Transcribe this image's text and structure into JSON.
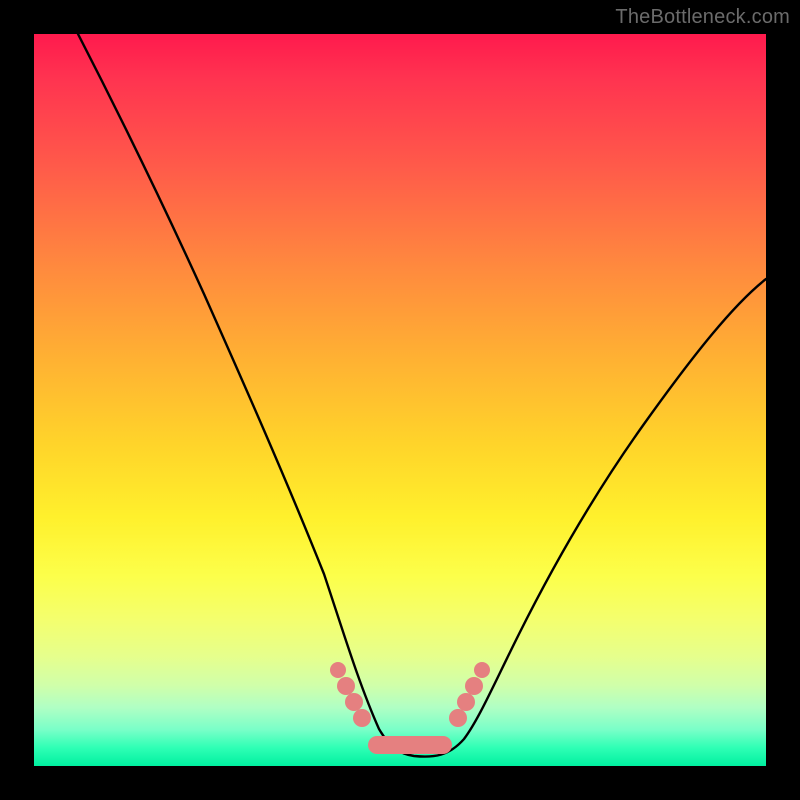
{
  "watermark": "TheBottleneck.com",
  "colors": {
    "frame": "#000000",
    "curve": "#000000",
    "markers": "#e58080",
    "gradient_stops": [
      "#ff1a4d",
      "#ff3350",
      "#ff5a4a",
      "#ff8a3e",
      "#ffb033",
      "#ffd42a",
      "#fff02c",
      "#fcff4a",
      "#f4ff6e",
      "#e6ff8c",
      "#d0ffaa",
      "#b0ffc4",
      "#7affc8",
      "#2fffb5",
      "#00f0a0"
    ]
  },
  "chart_data": {
    "type": "line",
    "title": "",
    "xlabel": "",
    "ylabel": "",
    "xlim": [
      0,
      100
    ],
    "ylim": [
      0,
      100
    ],
    "grid": false,
    "series": [
      {
        "name": "bottleneck-curve",
        "x": [
          6,
          10,
          14,
          18,
          22,
          26,
          30,
          34,
          38,
          41,
          43,
          45,
          47,
          49,
          51,
          53,
          55,
          57,
          60,
          64,
          68,
          72,
          76,
          80,
          84,
          88,
          92,
          96,
          100
        ],
        "y": [
          100,
          92,
          84,
          76,
          68,
          60,
          52,
          44,
          36,
          28,
          22,
          16,
          10,
          6,
          4,
          4,
          5,
          8,
          12,
          18,
          24,
          30,
          36,
          42,
          48,
          53,
          58,
          62,
          66
        ]
      }
    ],
    "annotations": {
      "left_cluster_dots": [
        {
          "x": 41,
          "y": 14
        },
        {
          "x": 42,
          "y": 12
        },
        {
          "x": 43,
          "y": 10
        },
        {
          "x": 44,
          "y": 8
        }
      ],
      "right_cluster_dots": [
        {
          "x": 57,
          "y": 8
        },
        {
          "x": 58,
          "y": 10
        },
        {
          "x": 59,
          "y": 12
        },
        {
          "x": 60,
          "y": 14
        }
      ],
      "flat_pill": {
        "x0": 45,
        "x1": 55,
        "y": 4
      }
    }
  }
}
